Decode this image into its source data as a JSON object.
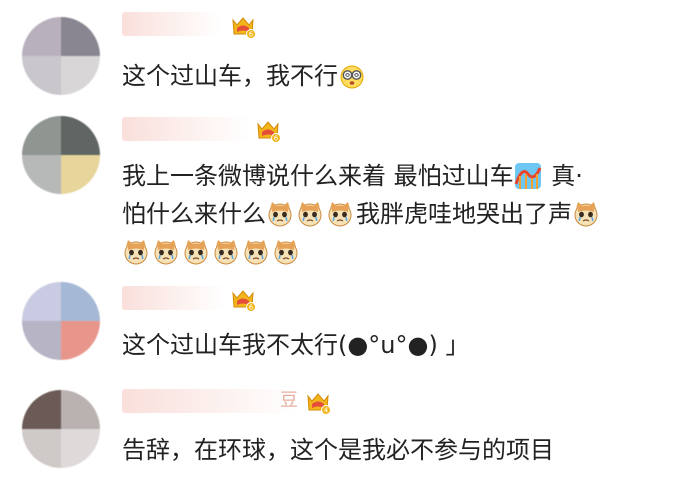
{
  "colors": {
    "text": "#222222",
    "badge_gold": "#f2b51a",
    "badge_red": "#e54f3a",
    "username_blur": "#f5c4be"
  },
  "comments": [
    {
      "username_tail": "",
      "badge": {
        "icon": "crown-level-badge-icon",
        "level": "6"
      },
      "lines": [
        {
          "segments": [
            {
              "text": "这个过山车，我不行"
            },
            {
              "emoji": "dizzy-face-emoji"
            }
          ]
        }
      ],
      "avatar_colors": [
        "#b8b1bd",
        "#8a8691",
        "#c9c6cc",
        "#d9d6d8"
      ]
    },
    {
      "username_tail": "",
      "badge": {
        "icon": "crown-level-badge-icon",
        "level": "6"
      },
      "lines": [
        {
          "segments": [
            {
              "text": "我上一条微博说什么来着 最怕过山车"
            },
            {
              "emoji": "roller-coaster-emoji"
            },
            {
              "text": " 真·"
            }
          ]
        },
        {
          "segments": [
            {
              "text": "怕什么来什么"
            },
            {
              "emoji": "crying-cat-emoji"
            },
            {
              "emoji": "crying-cat-emoji"
            },
            {
              "emoji": "crying-cat-emoji"
            },
            {
              "text": "我胖虎哇地哭出了声"
            },
            {
              "emoji": "crying-cat-emoji"
            }
          ]
        },
        {
          "segments": [
            {
              "emoji": "crying-cat-emoji"
            },
            {
              "emoji": "crying-cat-emoji"
            },
            {
              "emoji": "crying-cat-emoji"
            },
            {
              "emoji": "crying-cat-emoji"
            },
            {
              "emoji": "crying-cat-emoji"
            },
            {
              "emoji": "crying-cat-emoji"
            }
          ]
        }
      ],
      "avatar_colors": [
        "#8f9591",
        "#5f6663",
        "#b6b9b7",
        "#e7d59b"
      ]
    },
    {
      "username_tail": "",
      "badge": {
        "icon": "crown-level-badge-icon",
        "level": "6"
      },
      "lines": [
        {
          "segments": [
            {
              "text": "这个过山车我不太行(●°u°●) 」"
            }
          ]
        }
      ],
      "avatar_colors": [
        "#c9cbe2",
        "#a5b9d6",
        "#b7b4c6",
        "#e8968c"
      ]
    },
    {
      "username_tail": "豆",
      "badge": {
        "icon": "crown-level-badge-icon",
        "level": "4"
      },
      "lines": [
        {
          "segments": [
            {
              "text": "告辞，在环球，这个是我必不参与的项目"
            }
          ]
        }
      ],
      "avatar_colors": [
        "#6b5a55",
        "#b9b2b0",
        "#cfc9c8",
        "#dedad9"
      ]
    }
  ]
}
